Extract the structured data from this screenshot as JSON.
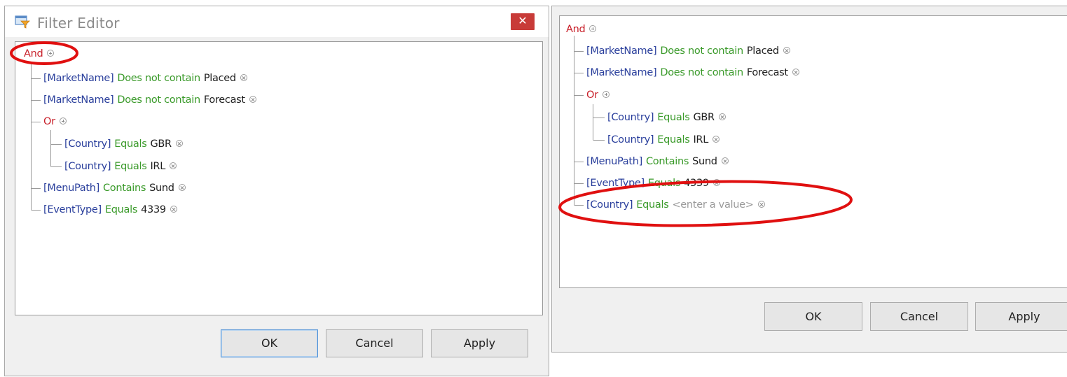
{
  "left_dialog": {
    "title": "Filter Editor",
    "close_label": "✕",
    "tree": [
      {
        "group": "And"
      },
      {
        "field": "[MarketName]",
        "op": "Does not contain",
        "value": "Placed"
      },
      {
        "field": "[MarketName]",
        "op": "Does not contain",
        "value": "Forecast"
      },
      {
        "group": "Or"
      },
      {
        "field": "[Country]",
        "op": "Equals",
        "value": "GBR"
      },
      {
        "field": "[Country]",
        "op": "Equals",
        "value": "IRL"
      },
      {
        "field": "[MenuPath]",
        "op": "Contains",
        "value": "Sund"
      },
      {
        "field": "[EventType]",
        "op": "Equals",
        "value": "4339"
      }
    ],
    "buttons": {
      "ok": "OK",
      "cancel": "Cancel",
      "apply": "Apply"
    }
  },
  "right_dialog": {
    "tree": [
      {
        "group": "And"
      },
      {
        "field": "[MarketName]",
        "op": "Does not contain",
        "value": "Placed"
      },
      {
        "field": "[MarketName]",
        "op": "Does not contain",
        "value": "Forecast"
      },
      {
        "group": "Or"
      },
      {
        "field": "[Country]",
        "op": "Equals",
        "value": "GBR"
      },
      {
        "field": "[Country]",
        "op": "Equals",
        "value": "IRL"
      },
      {
        "field": "[MenuPath]",
        "op": "Contains",
        "value": "Sund"
      },
      {
        "field": "[EventType]",
        "op": "Equals",
        "value": "4339"
      },
      {
        "field": "[Country]",
        "op": "Equals",
        "placeholder": "<enter a value>"
      }
    ],
    "buttons": {
      "ok": "OK",
      "cancel": "Cancel",
      "apply": "Apply"
    }
  },
  "annotation_color": "#e01010"
}
